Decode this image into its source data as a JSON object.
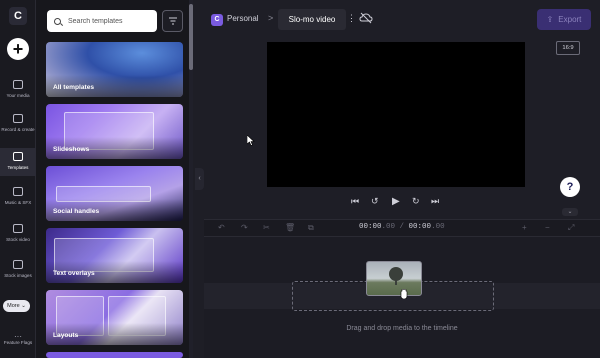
{
  "rail": {
    "items": [
      {
        "label": "Your media",
        "icon": "folder-icon"
      },
      {
        "label": "Record & create",
        "icon": "camera-icon"
      },
      {
        "label": "Templates",
        "icon": "templates-icon",
        "active": true
      },
      {
        "label": "Music & SFX",
        "icon": "music-icon"
      },
      {
        "label": "Stock video",
        "icon": "film-icon"
      },
      {
        "label": "Stock images",
        "icon": "image-icon"
      }
    ],
    "more_label": "More",
    "feature_flags_label": "Feature Flags"
  },
  "panel": {
    "search_placeholder": "Search templates",
    "cards": [
      {
        "label": "All templates"
      },
      {
        "label": "Slideshows"
      },
      {
        "label": "Social handles"
      },
      {
        "label": "Text overlays"
      },
      {
        "label": "Layouts"
      }
    ]
  },
  "header": {
    "workspace_initial": "C",
    "workspace_name": "Personal",
    "separator": ">",
    "project_title": "Slo-mo video",
    "export_label": "Export"
  },
  "preview": {
    "aspect_ratio": "16:9"
  },
  "timeline": {
    "current_time": "00:00",
    "current_frac": ".00",
    "total_time": "00:00",
    "total_frac": ".00",
    "drop_hint": "Drag and drop media to the timeline"
  },
  "colors": {
    "accent": "#7a5be0",
    "export_bg": "#3a2f73",
    "background": "#1e1e26"
  }
}
